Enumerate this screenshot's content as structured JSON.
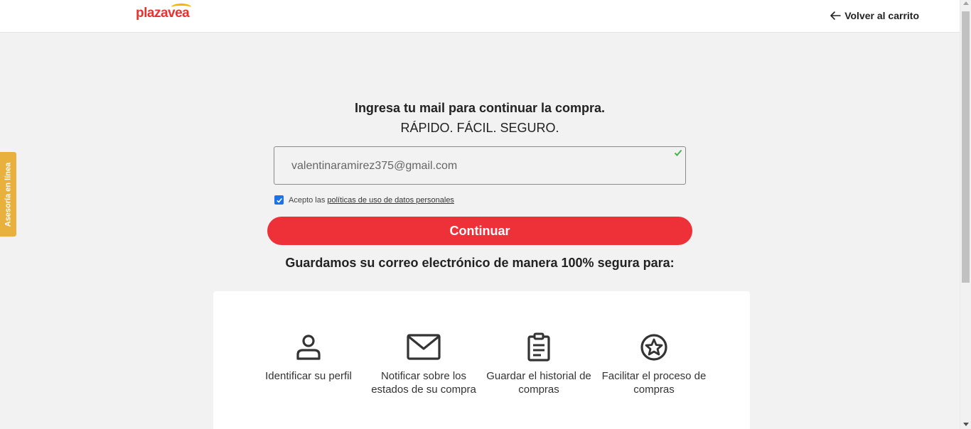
{
  "header": {
    "logo_plaza": "plaza",
    "logo_vea": "vea",
    "back_label": "Volver al carrito"
  },
  "side_tab": {
    "label": "Asesoría en línea"
  },
  "main": {
    "title": "Ingresa tu mail para continuar la compra.",
    "subtitle": "RÁPIDO. FÁCIL. SEGURO.",
    "email_value": "valentinaramirez375@gmail.com",
    "terms_prefix": "Acepto las",
    "terms_link": "políticas de uso de datos personales",
    "terms_checked": true,
    "continue_label": "Continuar",
    "secure_title": "Guardamos su correo electrónico de manera 100% segura para:"
  },
  "features": [
    {
      "icon": "user-icon",
      "label": "Identificar su perfil"
    },
    {
      "icon": "mail-icon",
      "label": "Notificar sobre los estados de su compra"
    },
    {
      "icon": "clipboard-icon",
      "label": "Guardar el historial de compras"
    },
    {
      "icon": "star-icon",
      "label": "Facilitar el proceso de compras"
    }
  ],
  "colors": {
    "brand_red": "#ee3038",
    "side_tab": "#e8b13e",
    "checkbox": "#1a73e8",
    "valid_check": "#4caf50"
  }
}
